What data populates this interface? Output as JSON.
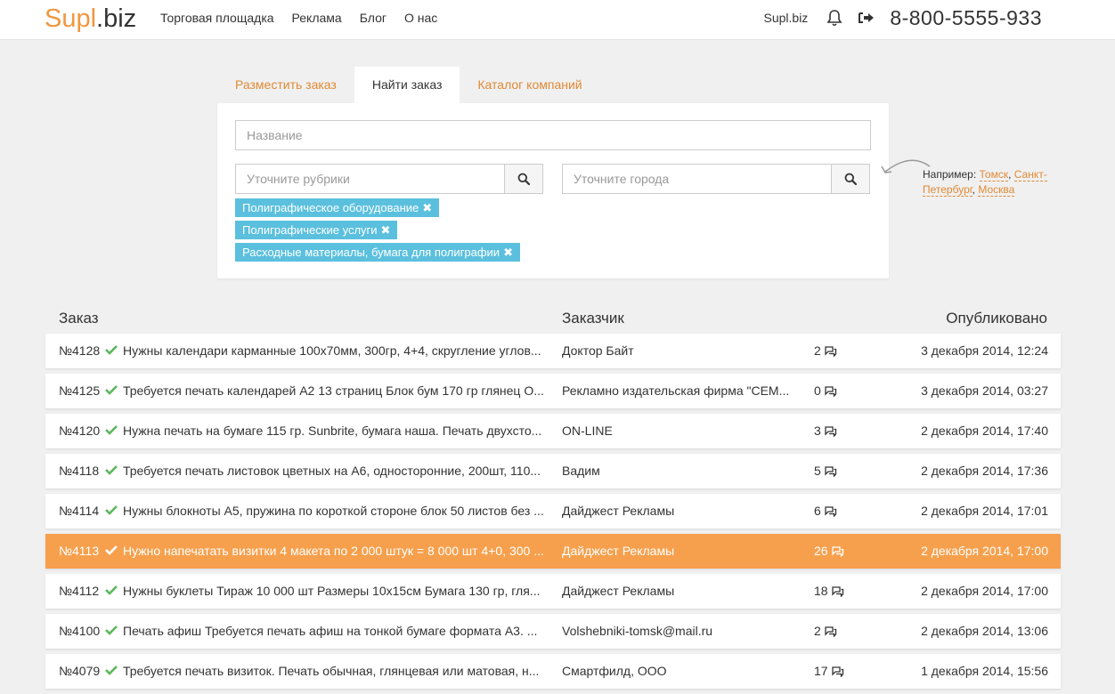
{
  "header": {
    "logo_part1": "Supl",
    "logo_part2": ".biz",
    "nav": [
      "Торговая площадка",
      "Реклама",
      "Блог",
      "О нас"
    ],
    "site_link": "Supl.biz",
    "phone": "8-800-5555-933"
  },
  "tabs": [
    "Разместить заказ",
    "Найти заказ",
    "Каталог компаний"
  ],
  "active_tab": 1,
  "search": {
    "name_placeholder": "Название",
    "rubric_placeholder": "Уточните рубрики",
    "city_placeholder": "Уточните города",
    "tags": [
      "Полиграфическое оборудование",
      "Полиграфические услуги",
      "Расходные материалы, бумага для полиграфии"
    ]
  },
  "hint": {
    "prefix": "Например:",
    "city1": "Томск",
    "city2": "Санкт-Петербург",
    "city3": "Москва"
  },
  "table": {
    "col_order": "Заказ",
    "col_customer": "Заказчик",
    "col_published": "Опубликовано",
    "rows": [
      {
        "num": "№4128",
        "title": "Нужны календари карманные 100х70мм, 300гр, 4+4, скругление углов...",
        "customer": "Доктор Байт",
        "comments": "2",
        "date": "3 декабря 2014, 12:24"
      },
      {
        "num": "№4125",
        "title": "Требуется печать календарей А2 13 страниц Блок бум 170 гр глянец О...",
        "customer": "Рекламно издательская фирма \"СЕМ...",
        "comments": "0",
        "date": "3 декабря 2014, 03:27"
      },
      {
        "num": "№4120",
        "title": "Нужна печать на бумаге 115 гр. Sunbrite, бумага наша. Печать двухсто...",
        "customer": "ON-LINE",
        "comments": "3",
        "date": "2 декабря 2014, 17:40"
      },
      {
        "num": "№4118",
        "title": "Требуется печать листовок цветных на А6, односторонние, 200шт, 110...",
        "customer": "Вадим",
        "comments": "5",
        "date": "2 декабря 2014, 17:36"
      },
      {
        "num": "№4114",
        "title": "Нужны блокноты А5, пружина по короткой стороне блок 50 листов без ...",
        "customer": "Дайджест Рекламы",
        "comments": "6",
        "date": "2 декабря 2014, 17:01"
      },
      {
        "num": "№4113",
        "title": "Нужно напечатать визитки 4 макета по 2 000 штук = 8 000 шт 4+0, 300 ...",
        "customer": "Дайджест Рекламы",
        "comments": "26",
        "date": "2 декабря 2014, 17:00"
      },
      {
        "num": "№4112",
        "title": "Нужны буклеты Тираж 10 000 шт Размеры 10х15см Бумага 130 гр, гля...",
        "customer": "Дайджест Рекламы",
        "comments": "18",
        "date": "2 декабря 2014, 17:00"
      },
      {
        "num": "№4100",
        "title": "Печать афиш Требуется печать афиш на тонкой бумаге формата А3. ...",
        "customer": "Volshebniki-tomsk@mail.ru",
        "comments": "2",
        "date": "2 декабря 2014, 13:06"
      },
      {
        "num": "№4079",
        "title": "Требуется печать визиток. Печать обычная, глянцевая или матовая, н...",
        "customer": "Смартфилд, ООО",
        "comments": "17",
        "date": "1 декабря 2014, 15:56"
      }
    ]
  },
  "colors": {
    "accent": "#f0973f",
    "highlight_row": "#f6a04d",
    "tag_bg": "#5bc0de",
    "check": "#5cb85c"
  }
}
